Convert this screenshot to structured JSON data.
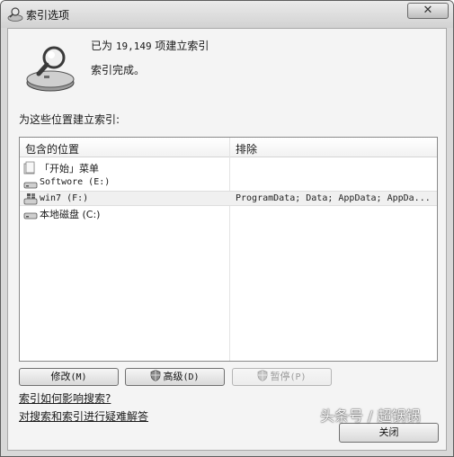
{
  "window": {
    "title": "索引选项",
    "close_glyph": "✕"
  },
  "status": {
    "line1_prefix": "已为 ",
    "count": "19,149",
    "line1_suffix": " 项建立索引",
    "line2": "索引完成。"
  },
  "locations_label": "为这些位置建立索引:",
  "table": {
    "columns": [
      "包含的位置",
      "排除"
    ],
    "rows": [
      {
        "name": "「开始」菜单",
        "exclude": "",
        "icon": "folder-icon",
        "mono": false,
        "selected": false
      },
      {
        "name": "Softwore (E:)",
        "exclude": "",
        "icon": "drive-icon",
        "mono": true,
        "selected": false
      },
      {
        "name": "win7 (F:)",
        "exclude": "ProgramData; Data; AppData; AppDa...",
        "icon": "windows-drive-icon",
        "mono": true,
        "selected": true
      },
      {
        "name": "本地磁盘 (C:)",
        "exclude": "",
        "icon": "drive-icon",
        "mono": false,
        "selected": false
      }
    ]
  },
  "buttons": {
    "modify": "修改",
    "modify_key": "(M)",
    "advanced": "高级",
    "advanced_key": "(D)",
    "pause": "暂停",
    "pause_key": "(P)",
    "close": "关闭"
  },
  "links": {
    "help_search": "索引如何影响搜索?",
    "troubleshoot": "对搜索和索引进行疑难解答"
  },
  "watermark": "头条号 / 超锅锅",
  "colors": {
    "window_frame": "#d8d8d8",
    "client_bg": "#f4f4f4",
    "list_bg": "#ffffff",
    "selected_row": "#f0f0f0"
  }
}
